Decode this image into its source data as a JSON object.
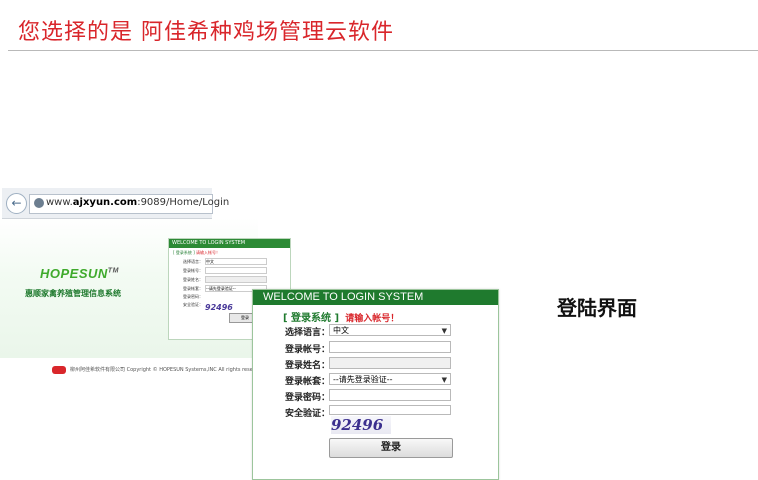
{
  "header": {
    "title": "您选择的是  阿佳希种鸡场管理云软件"
  },
  "browser": {
    "url_prefix": "www.",
    "url_domain": "ajxyun.com",
    "url_rest": ":9089/Home/Login",
    "back_glyph": "←"
  },
  "background_screen": {
    "brand": "HOPESUN",
    "brand_mark": "TM",
    "brand_subtitle": "惠顺家禽养殖管理信息系统",
    "mini_head": "WELCOME TO LOGIN SYSTEM",
    "mini_sys": "[ 登录系统 ]",
    "mini_hint": "请输入帐号！",
    "mini_labels": [
      "选择语言：",
      "登录帐号：",
      "登录姓名：",
      "登录帐套：",
      "登录密码：",
      "安全验证："
    ],
    "mini_lang_value": "中文",
    "mini_account_value": "--请先登录验证--",
    "mini_captcha": "92496",
    "mini_button": "登录",
    "footer": "柳州阿佳希软件有限公司  Copyright © HOPESUN Systems,INC  All rights reser"
  },
  "login": {
    "header": "WELCOME TO LOGIN SYSTEM",
    "sys_tag": "[ 登录系统 ]",
    "hint": "请输入帐号！",
    "fields": {
      "language_label": "选择语言：",
      "language_value": "中文",
      "account_label": "登录帐号：",
      "name_label": "登录姓名：",
      "set_label": "登录帐套：",
      "set_value": "--请先登录验证--",
      "password_label": "登录密码：",
      "verify_label": "安全验证："
    },
    "captcha": "92496",
    "button": "登录"
  },
  "side_label": "登陆界面"
}
